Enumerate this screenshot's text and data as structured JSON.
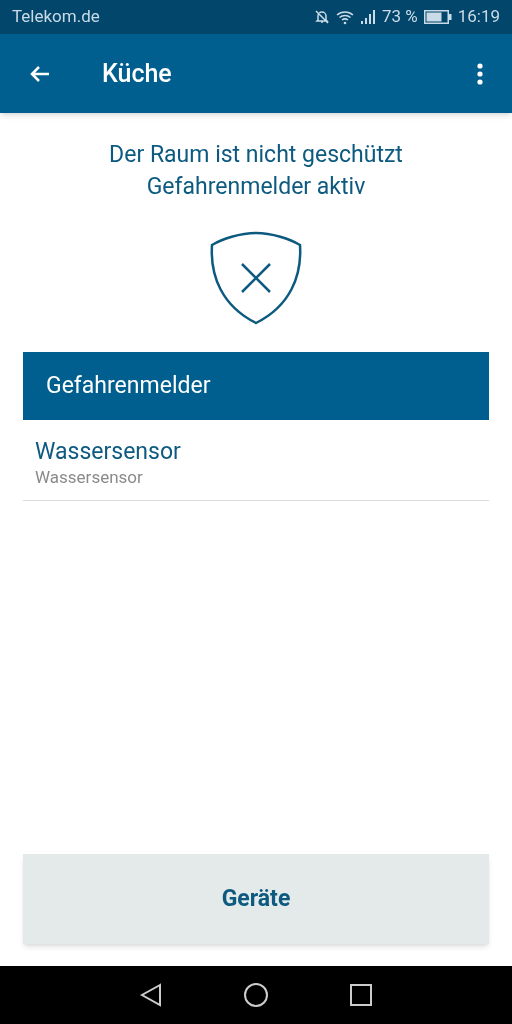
{
  "status_bar": {
    "carrier": "Telekom.de",
    "battery": "73 %",
    "time": "16:19"
  },
  "app_bar": {
    "title": "Küche"
  },
  "status_lines": [
    "Der Raum ist nicht geschützt",
    "Gefahrenmelder aktiv"
  ],
  "sections": [
    {
      "title": "Gefahrenmelder",
      "items": [
        {
          "name": "Wassersensor",
          "type": "Wassersensor"
        }
      ]
    }
  ],
  "bottom_button": "Geräte"
}
